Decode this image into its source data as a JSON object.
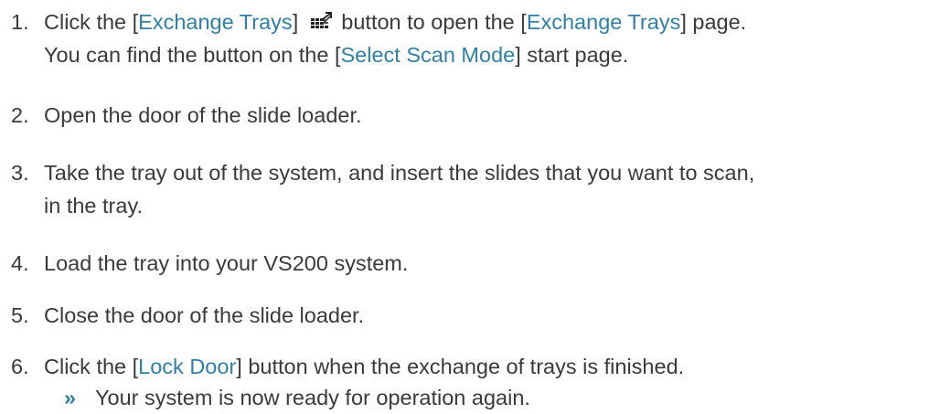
{
  "steps": [
    {
      "num": "1.",
      "pre": "Click the [",
      "ui1": "Exchange Trays",
      "mid1": "] ",
      "icon": "exchange-trays-icon",
      "mid2": " button to open the [",
      "ui2": "Exchange Trays",
      "post": "] page.",
      "line2_pre": "You can find the button on the [",
      "line2_ui": "Select Scan Mode",
      "line2_post": "] start page."
    },
    {
      "num": "2.",
      "text": "Open the door of the slide loader."
    },
    {
      "num": "3.",
      "text": "Take the tray out of the system, and insert the slides that you want to scan,",
      "line2": "in the tray."
    },
    {
      "num": "4.",
      "text": "Load the tray into your VS200 system."
    },
    {
      "num": "5.",
      "text": "Close the door of the slide loader."
    },
    {
      "num": "6.",
      "pre": "Click the [",
      "ui": "Lock Door",
      "post": "] button when the exchange of trays is finished."
    }
  ],
  "result": {
    "marker": "»",
    "text": "Your system is now ready for operation again."
  },
  "colors": {
    "text": "#3a3a3a",
    "link": "#2f7fa8"
  }
}
